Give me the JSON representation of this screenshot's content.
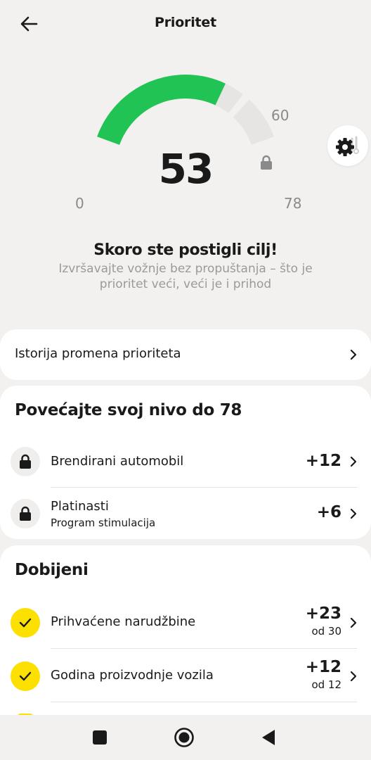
{
  "header": {
    "title": "Prioritet"
  },
  "gauge": {
    "score": "53",
    "value": 53,
    "target": 60,
    "max": 78,
    "tick_min": "0",
    "tick_target": "60",
    "tick_max": "78",
    "fill_color": "#21c454",
    "track_color": "#e6e5e3"
  },
  "message": {
    "headline": "Skoro ste postigli cilj!",
    "subtext": "Izvršavajte vožnje bez propuštanja – što je prioritet veći, veći je i prihod"
  },
  "history": {
    "label": "Istorija promena prioriteta"
  },
  "increase": {
    "title": "Povećajte svoj nivo do 78",
    "items": [
      {
        "label": "Brendirani automobil",
        "sub": "",
        "value": "+12"
      },
      {
        "label": "Platinasti",
        "sub": "Program stimulacija",
        "value": "+6"
      }
    ]
  },
  "earned": {
    "title": "Dobijeni",
    "items": [
      {
        "label": "Prihvaćene narudžbine",
        "value": "+23",
        "of": "od 30"
      },
      {
        "label": "Godina proizvodnje vozila",
        "value": "+12",
        "of": "od 12"
      }
    ]
  },
  "colors": {
    "accent_yellow": "#fce000",
    "green": "#21c454"
  },
  "icons": {
    "back": "arrow-left-icon",
    "settings": "gear-icon",
    "lock": "lock-icon",
    "check": "check-icon",
    "chevron": "chevron-right-icon"
  }
}
